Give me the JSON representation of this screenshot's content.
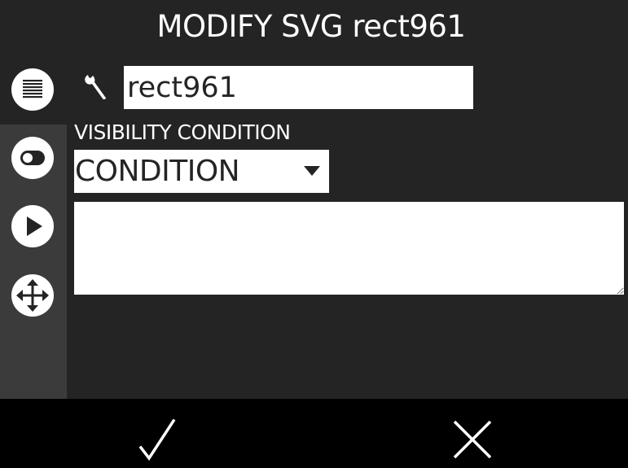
{
  "dialog": {
    "title": "MODIFY SVG rect961"
  },
  "sidebar": {
    "items": [
      {
        "name": "properties",
        "icon": "list-icon"
      },
      {
        "name": "visibility",
        "icon": "toggle-icon"
      },
      {
        "name": "animation",
        "icon": "play-icon"
      },
      {
        "name": "move",
        "icon": "move-arrows-icon"
      }
    ]
  },
  "element": {
    "icon": "wrench-icon",
    "name_value": "rect961"
  },
  "visibility": {
    "label": "VISIBILITY CONDITION",
    "selected": "CONDITION",
    "condition_text": ""
  },
  "footer": {
    "confirm_icon": "checkmark-icon",
    "cancel_icon": "close-icon"
  },
  "colors": {
    "background": "#242424",
    "sidebar": "#3b3b3b",
    "footer": "#000000",
    "input": "#ffffff",
    "text": "#ffffff"
  }
}
